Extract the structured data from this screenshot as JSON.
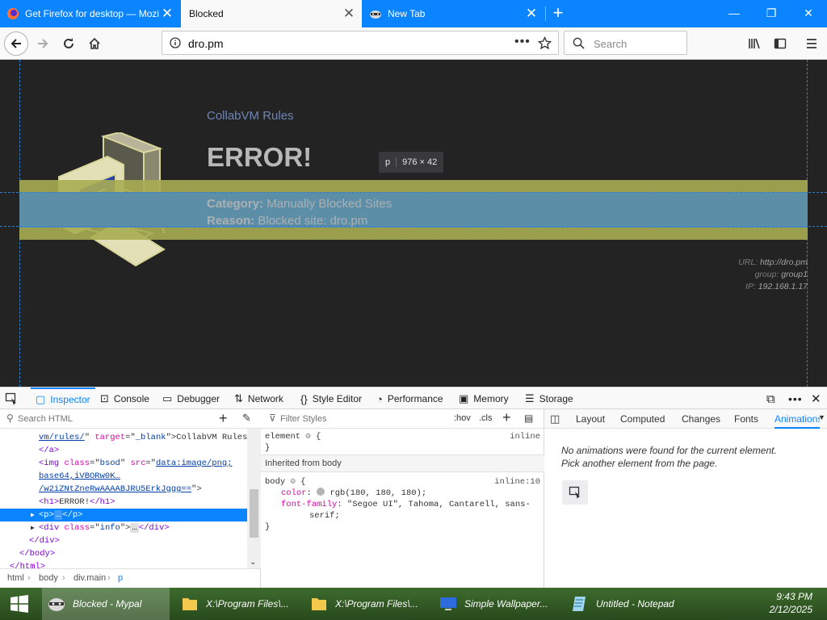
{
  "browser": {
    "tabs": [
      {
        "title": "Get Firefox for desktop — Mozill",
        "active": false,
        "icon": "firefox-icon"
      },
      {
        "title": "Blocked",
        "active": true,
        "icon": "none"
      },
      {
        "title": "New Tab",
        "active": false,
        "icon": "raccoon-icon"
      }
    ],
    "url": "dro.pm",
    "search_placeholder": "Search"
  },
  "page": {
    "link_text": "CollabVM Rules",
    "heading": "ERROR!",
    "category_label": "Category:",
    "category_value": "Manually Blocked Sites",
    "reason_label": "Reason:",
    "reason_value": "Blocked site: dro.pm",
    "info": {
      "url_label": "URL:",
      "url_value": "http://dro.pm",
      "group_label": "group:",
      "group_value": "group1",
      "ip_label": "IP:",
      "ip_value": "192.168.1.17"
    },
    "tooltip": {
      "tag": "p",
      "size": "976 × 42"
    },
    "highlight_color": "#5d8ea7",
    "margin_color": "#a8ad52"
  },
  "devtools": {
    "tabs": [
      "Inspector",
      "Console",
      "Debugger",
      "Network",
      "Style Editor",
      "Performance",
      "Memory",
      "Storage"
    ],
    "selected_tab": "Inspector",
    "markup_search_placeholder": "Search HTML",
    "markup_lines": [
      {
        "indent": 50,
        "parts": [
          [
            "lnk",
            "vm/rules/"
          ],
          [
            "",
            "\" "
          ],
          [
            "attr",
            "target"
          ],
          [
            "",
            "=\""
          ],
          [
            "val",
            "_blank"
          ],
          [
            "",
            "\">CollabVM Rules"
          ]
        ]
      },
      {
        "indent": 50,
        "parts": [
          [
            "tagc",
            "</a>"
          ]
        ]
      },
      {
        "indent": 50,
        "parts": [
          [
            "tagc",
            "<img "
          ],
          [
            "attr",
            "class"
          ],
          [
            "",
            "=\""
          ],
          [
            "val",
            "bsod"
          ],
          [
            "",
            "\" "
          ],
          [
            "attr",
            "src"
          ],
          [
            "",
            "=\""
          ],
          [
            "lnk",
            "data:image/png;"
          ]
        ]
      },
      {
        "indent": 50,
        "parts": [
          [
            "lnk",
            "base64,iVBORw0K…"
          ]
        ]
      },
      {
        "indent": 50,
        "parts": [
          [
            "lnk",
            "/w2iZNtZneRwAAAABJRU5ErkJggg=="
          ],
          [
            "",
            "\">"
          ]
        ]
      },
      {
        "indent": 50,
        "parts": [
          [
            "tagc",
            "<h1>"
          ],
          [
            "",
            "ERROR!"
          ],
          [
            "tagc",
            "</h1>"
          ]
        ]
      },
      {
        "indent": 50,
        "parts": [
          [
            "",
            "<p>"
          ],
          [
            "",
            "…"
          ],
          [
            "",
            "</p>"
          ]
        ],
        "selected": true
      },
      {
        "indent": 50,
        "parts": [
          [
            "tagc",
            "<div "
          ],
          [
            "attr",
            "class"
          ],
          [
            "",
            "=\""
          ],
          [
            "val",
            "info"
          ],
          [
            "",
            "\">"
          ],
          [
            "",
            "…"
          ],
          [
            "tagc",
            "</div>"
          ]
        ]
      },
      {
        "indent": 38,
        "parts": [
          [
            "tagc",
            "</div>"
          ]
        ]
      },
      {
        "indent": 26,
        "parts": [
          [
            "tagc",
            "</body>"
          ]
        ]
      },
      {
        "indent": 14,
        "parts": [
          [
            "tagc",
            "</html>"
          ]
        ]
      }
    ],
    "breadcrumbs": [
      "html",
      "body",
      "div.main",
      "p"
    ],
    "rules": {
      "filter_placeholder": "Filter Styles",
      "hov": ":hov",
      "cls": ".cls",
      "element_selector": "element",
      "element_source": "inline",
      "inherited_header": "Inherited from body",
      "body_selector": "body",
      "body_source": "inline:10",
      "color_prop": "color",
      "color_value": "rgb(180, 180, 180);",
      "font_prop": "font-family",
      "font_value_1": "\"Segoe UI\", Tahoma, Cantarell, sans-",
      "font_value_2": "serif;"
    },
    "right_tabs": [
      "Layout",
      "Computed",
      "Changes",
      "Fonts",
      "Animations"
    ],
    "right_selected": "Animations",
    "animation_msg_1": "No animations were found for the current element.",
    "animation_msg_2": "Pick another element from the page."
  },
  "taskbar": {
    "items": [
      {
        "label": "Blocked - Mypal",
        "active": true
      },
      {
        "label": "X:\\Program Files\\...",
        "active": false
      },
      {
        "label": "X:\\Program Files\\...",
        "active": false
      },
      {
        "label": "Simple Wallpaper...",
        "active": false
      },
      {
        "label": "Untitled - Notepad",
        "active": false
      }
    ],
    "time": "9:43 PM",
    "date": "2/12/2025"
  }
}
